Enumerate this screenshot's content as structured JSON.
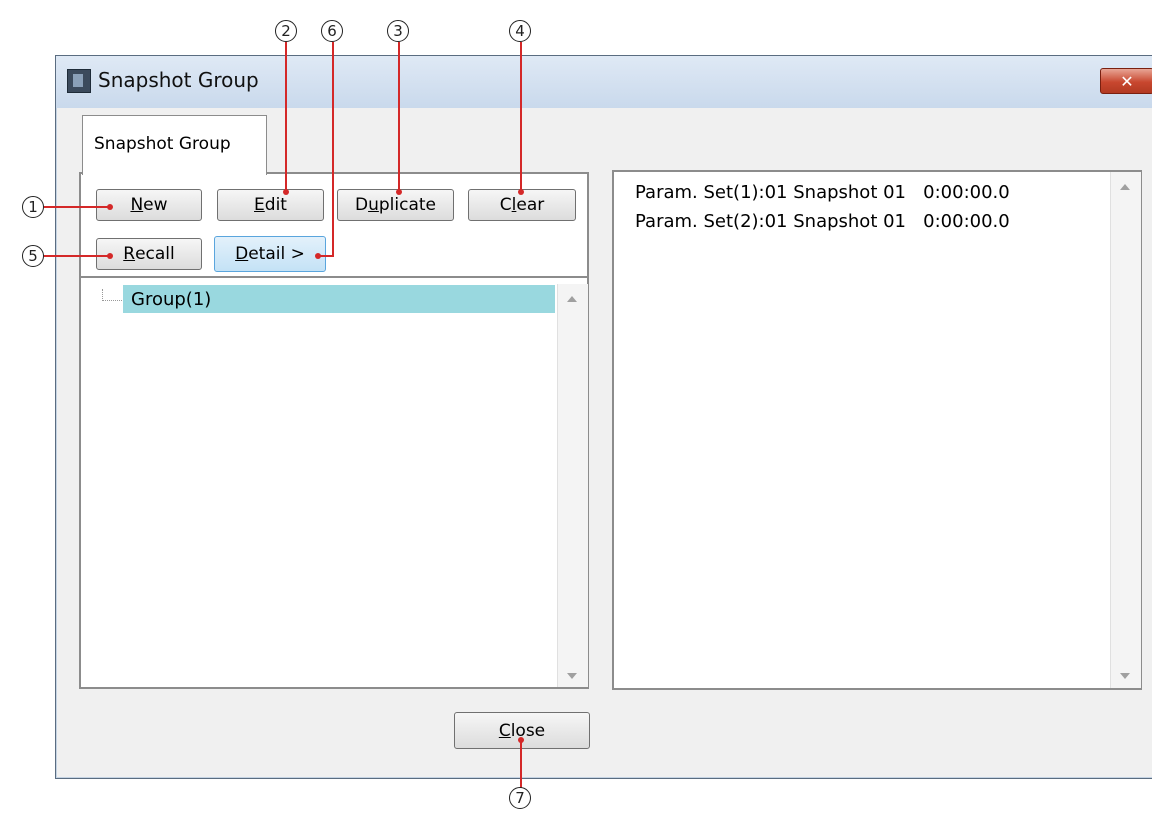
{
  "window": {
    "title": "Snapshot Group",
    "close_glyph": "✕"
  },
  "tab": {
    "label": "Snapshot Group"
  },
  "buttons": {
    "new": {
      "pre": "",
      "u": "N",
      "post": "ew"
    },
    "edit": {
      "pre": "",
      "u": "E",
      "post": "dit"
    },
    "duplicate": {
      "pre": "D",
      "u": "u",
      "post": "plicate"
    },
    "clear": {
      "pre": "C",
      "u": "l",
      "post": "ear"
    },
    "recall": {
      "pre": "",
      "u": "R",
      "post": "ecall"
    },
    "detail": {
      "pre": "",
      "u": "D",
      "post": "etail >"
    },
    "close": {
      "pre": "",
      "u": "C",
      "post": "lose"
    }
  },
  "tree": {
    "items": [
      {
        "label": "Group(1)",
        "selected": true
      }
    ]
  },
  "params": [
    "Param. Set(1):01 Snapshot 01   0:00:00.0",
    "Param. Set(2):01 Snapshot 01   0:00:00.0"
  ],
  "callouts": {
    "c1": "1",
    "c2": "2",
    "c3": "3",
    "c4": "4",
    "c5": "5",
    "c6": "6",
    "c7": "7"
  },
  "colors": {
    "selection": "#99d8df",
    "callout_line": "#d42828",
    "active_button": "#c4e2f6",
    "close_button": "#c8472f"
  }
}
